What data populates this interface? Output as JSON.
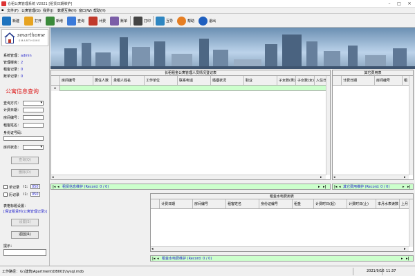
{
  "window": {
    "title": "仓租公寓管理系统 V2021 [租赁日期维护]"
  },
  "menu": [
    "文件(F)",
    "公寓管理(G)",
    "我界(J)",
    "数据互换(H)",
    "窗口(W)",
    "帮助(H)"
  ],
  "toolbar": [
    {
      "label": "新建",
      "icon": "new-doc-icon",
      "color": "#1e73be"
    },
    {
      "label": "打开",
      "icon": "open-folder-icon",
      "color": "#e6a320"
    },
    {
      "label": "新增",
      "icon": "add-user-icon",
      "color": "#3a8a3a"
    },
    {
      "label": "查询",
      "icon": "search-icon",
      "color": "#3b7ad9"
    },
    {
      "label": "计费",
      "icon": "calc-icon",
      "color": "#c0392b"
    },
    {
      "label": "账单",
      "icon": "ledger-icon",
      "color": "#7b5ea7"
    },
    {
      "label": "打印",
      "icon": "printer-icon",
      "color": "#444444"
    },
    {
      "label": "互导",
      "icon": "exchange-icon",
      "color": "#2e86c1"
    },
    {
      "label": "帮助",
      "icon": "help-icon",
      "color": "#e67e22"
    },
    {
      "label": "退出",
      "icon": "exit-icon",
      "color": "#1f5fbf"
    }
  ],
  "logo": {
    "line1": "smarthome",
    "line2": "SMARTHOME"
  },
  "info": [
    {
      "label": "系统管理：",
      "value": "admin"
    },
    {
      "label": "管理楼房：",
      "value": "2"
    },
    {
      "label": "租客记录：",
      "value": "0"
    },
    {
      "label": "账单记录：",
      "value": "0"
    }
  ],
  "query": {
    "title": "公寓信息查询",
    "fields": [
      "查询方式：",
      "计费日期：",
      "房间编号：",
      "租客姓名：",
      "身份证号码：",
      "房间状态："
    ],
    "query_btn": "查询(Q)",
    "delete_btn": "删除(D)",
    "chk1": "单记录",
    "chk1_label": "I1:",
    "chk1_val": "050",
    "chk2": "历记录",
    "chk2_label": "I1:",
    "chk2_val": "050",
    "table_set_label": "表格标题设置：",
    "table_set_link": "[保证租赁时(公寓管理记录)]",
    "set_btn": "设置(S)",
    "back_btn": "返回(R)",
    "tip_label": "提示："
  },
  "main_grid": {
    "caption": "长租租金公寓管理人员情况登记表",
    "columns": [
      "房间编号",
      "居住人数",
      "承租人姓名",
      "工作单位",
      "联系电话",
      "婚姻状况",
      "职业",
      "子女数(男)",
      "子女数(女)",
      "入住日"
    ],
    "nav_text": "租赁信息维护 (Record: 0 / 0)"
  },
  "side_grid": {
    "caption": "其它费用表",
    "columns": [
      "计费日期",
      "房间编号",
      "租"
    ],
    "nav_text": "其它费用维护 (Record: 0 / 0)"
  },
  "bottom_grid": {
    "caption": "租金水电费用表",
    "columns": [
      "计费日期",
      "房间编号",
      "租客姓名",
      "身份证编号",
      "租金",
      "计费时日(起)",
      "计费时日(止)",
      "本月水表读数",
      "上月"
    ],
    "nav_text": "租金水电费维护 (Record: 0 / 0)"
  },
  "status": {
    "path_label": "工作路径：",
    "path": "G:\\建筑\\Apartment\\DB001\\hysql.mdb",
    "date": "2021/9/16",
    "time": "11:37"
  }
}
